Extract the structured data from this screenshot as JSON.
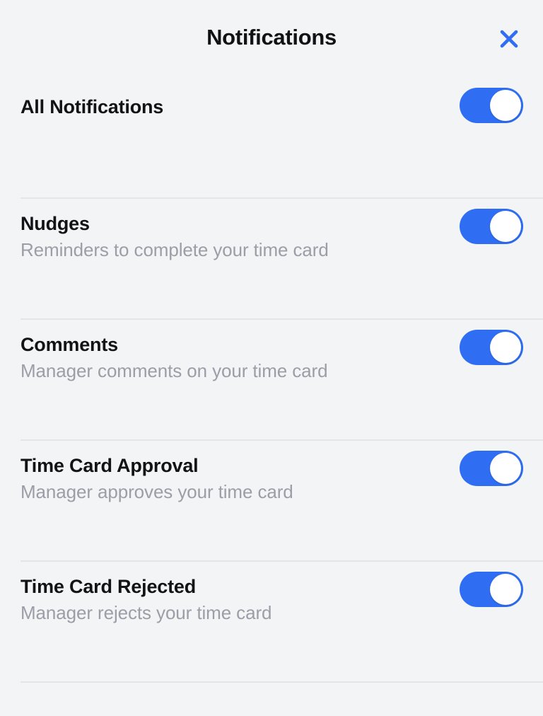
{
  "header": {
    "title": "Notifications",
    "close_icon": "close-icon",
    "close_label": "Close",
    "close_color": "#2f6ef2"
  },
  "theme": {
    "background": "#f3f4f6",
    "accent": "#2f6ef2",
    "title_color": "#121316",
    "subtitle_color": "#9b9ea6",
    "divider_color": "#e3e5e8",
    "knob_color": "#ffffff"
  },
  "settings": [
    {
      "id": "all-notifications",
      "title": "All Notifications",
      "subtitle": "",
      "toggle_state": "on"
    },
    {
      "id": "nudges",
      "title": "Nudges",
      "subtitle": "Reminders to complete your time card",
      "toggle_state": "on"
    },
    {
      "id": "comments",
      "title": "Comments",
      "subtitle": "Manager comments on your time card",
      "toggle_state": "on"
    },
    {
      "id": "time-card-approval",
      "title": "Time Card Approval",
      "subtitle": "Manager approves your time card",
      "toggle_state": "on"
    },
    {
      "id": "time-card-rejected",
      "title": "Time Card Rejected",
      "subtitle": "Manager rejects your time card",
      "toggle_state": "on"
    }
  ]
}
